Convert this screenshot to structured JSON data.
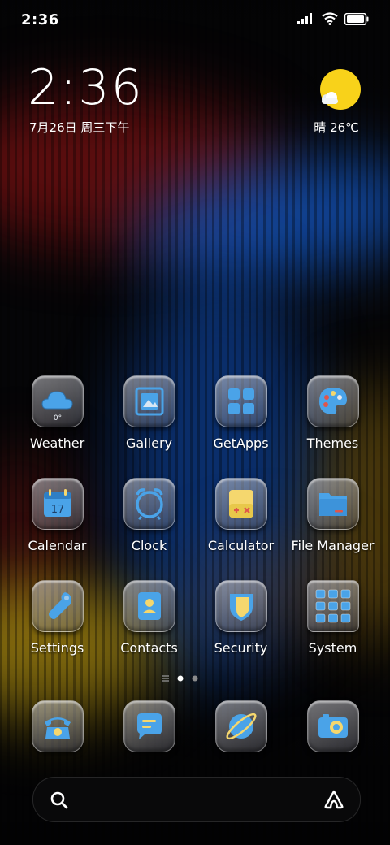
{
  "status": {
    "time": "2:36"
  },
  "widget": {
    "time": "2:36",
    "date": "7月26日 周三下午",
    "weather": "晴 26℃"
  },
  "apps": [
    {
      "label": "Weather",
      "icon": "weather-cloud-icon"
    },
    {
      "label": "Gallery",
      "icon": "gallery-icon"
    },
    {
      "label": "GetApps",
      "icon": "getapps-icon"
    },
    {
      "label": "Themes",
      "icon": "palette-icon"
    },
    {
      "label": "Calendar",
      "icon": "calendar-icon",
      "calendar_day": "17"
    },
    {
      "label": "Clock",
      "icon": "alarm-clock-icon"
    },
    {
      "label": "Calculator",
      "icon": "calculator-icon"
    },
    {
      "label": "File Manager",
      "icon": "folder-icon"
    },
    {
      "label": "Settings",
      "icon": "wrench-icon"
    },
    {
      "label": "Contacts",
      "icon": "contact-icon"
    },
    {
      "label": "Security",
      "icon": "shield-icon"
    },
    {
      "label": "System",
      "icon": "app-folder-icon"
    }
  ],
  "weather_icon_temp": "0°",
  "dock": [
    {
      "icon": "phone-icon"
    },
    {
      "icon": "messages-icon"
    },
    {
      "icon": "browser-icon"
    },
    {
      "icon": "camera-icon"
    }
  ],
  "page_indicator": {
    "pages": 2,
    "current": 1
  },
  "colors": {
    "icon_blue": "#4aa3e8",
    "icon_yellow": "#f5d76e",
    "icon_red": "#e0564a",
    "sun": "#f8d21a"
  }
}
